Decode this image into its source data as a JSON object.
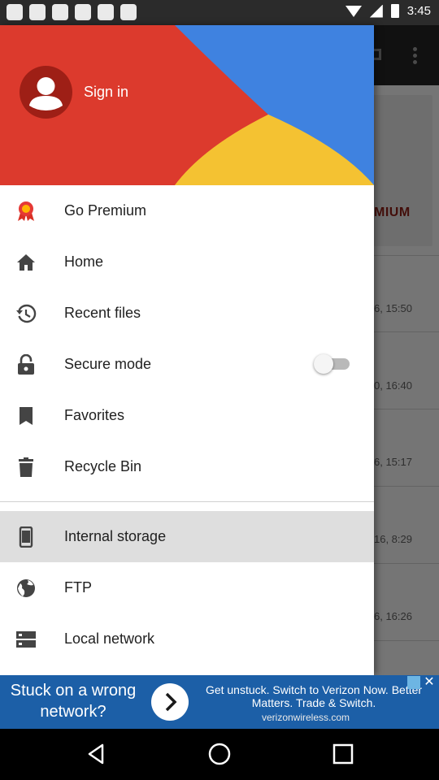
{
  "status_bar": {
    "time": "3:45",
    "notification_icons": [
      "app-icon",
      "app-icon",
      "app-icon",
      "cat-icon",
      "lock-icon",
      "app-icon"
    ]
  },
  "background": {
    "premium_text": "MIUM",
    "dates": [
      "6, 15:50",
      "0, 16:40",
      "6, 15:17",
      "16, 8:29",
      "6, 16:26"
    ]
  },
  "drawer": {
    "header": {
      "colors": {
        "red": "#dc3a2d",
        "blue": "#3f82e0",
        "yellow": "#f4c232"
      },
      "sign_in": "Sign in"
    },
    "items": [
      {
        "label": "Go Premium",
        "icon": "award-icon"
      },
      {
        "label": "Home",
        "icon": "home-icon"
      },
      {
        "label": "Recent files",
        "icon": "history-icon"
      },
      {
        "label": "Secure mode",
        "icon": "lock-icon",
        "toggle": false
      },
      {
        "label": "Favorites",
        "icon": "bookmark-icon"
      },
      {
        "label": "Recycle Bin",
        "icon": "trash-icon"
      }
    ],
    "storage": [
      {
        "label": "Internal storage",
        "icon": "phone-icon",
        "active": true
      },
      {
        "label": "FTP",
        "icon": "globe-icon"
      },
      {
        "label": "Local network",
        "icon": "server-icon"
      }
    ]
  },
  "ad": {
    "left_text": "Stuck on a wrong network?",
    "right_text": "Get unstuck. Switch to Verizon Now. Better Matters. Trade & Switch.",
    "domain": "verizonwireless.com",
    "color": "#1c5fa7"
  },
  "nav": [
    "back",
    "home",
    "recents"
  ]
}
